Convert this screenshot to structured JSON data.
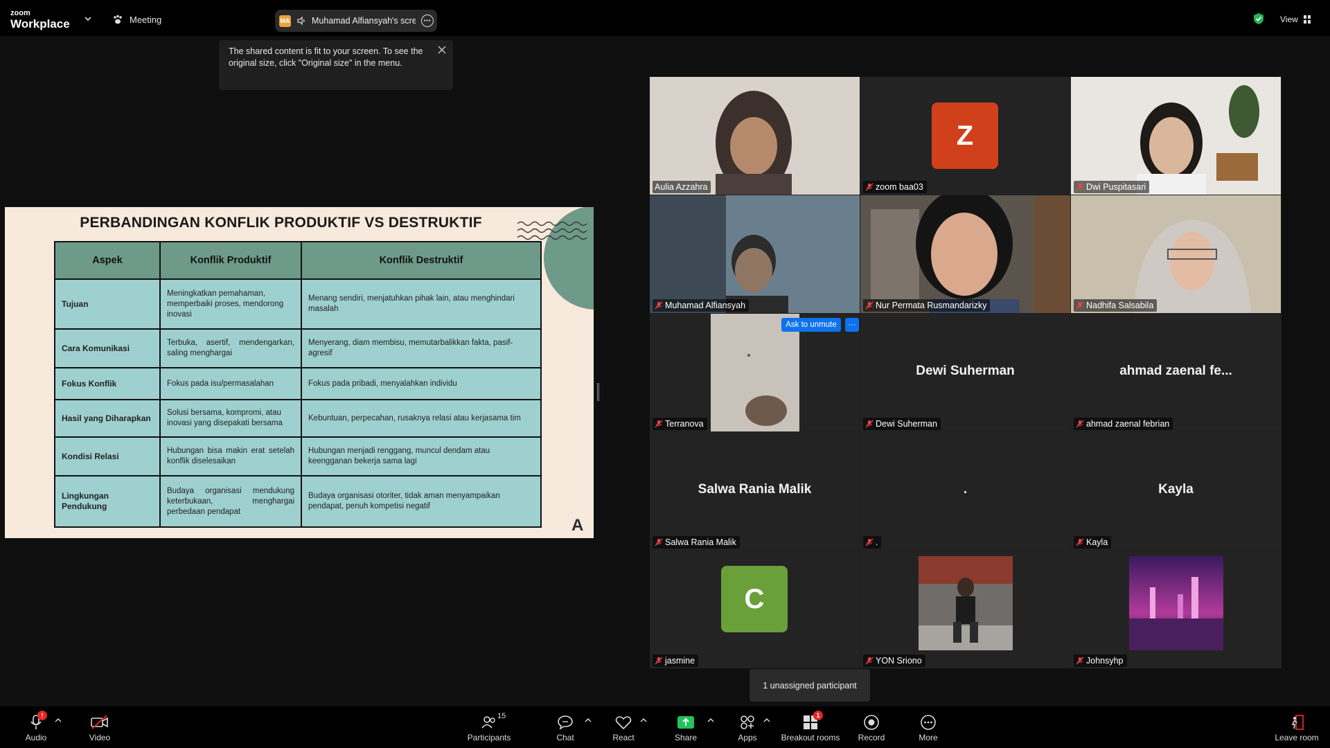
{
  "topbar": {
    "logo_small": "zoom",
    "logo_big": "Workplace",
    "meeting_label": "Meeting",
    "share_badge": "MA",
    "share_text": "Muhamad Alfiansyah's screen",
    "view_label": "View"
  },
  "tooltip": {
    "text": "The shared content is fit to your screen. To see the original size, click \"Original size\" in the menu."
  },
  "slide": {
    "title": "PERBANDINGAN KONFLIK PRODUKTIF VS DESTRUKTIF",
    "corner_letter": "A",
    "headers": [
      "Aspek",
      "Konflik Produktif",
      "Konflik Destruktif"
    ],
    "rows": [
      [
        "Tujuan",
        "Meningkatkan pemahaman, memperbaiki proses, mendorong inovasi",
        "Menang sendiri, menjatuhkan pihak lain, atau menghindari masalah"
      ],
      [
        "Cara Komunikasi",
        "Terbuka, asertif, mendengarkan, saling menghargai",
        "Menyerang, diam membisu, memutarbalikkan fakta, pasif-agresif"
      ],
      [
        "Fokus Konflik",
        "Fokus pada isu/permasalahan",
        "Fokus pada pribadi, menyalahkan individu"
      ],
      [
        "Hasil yang Diharapkan",
        "Solusi bersama, kompromi, atau inovasi yang disepakati bersama",
        "Kebuntuan, perpecahan, rusaknya relasi atau kerjasama tim"
      ],
      [
        "Kondisi Relasi",
        "Hubungan bisa makin erat setelah konflik diselesaikan",
        "Hubungan menjadi renggang, muncul dendam atau keengganan bekerja sama lagi"
      ],
      [
        "Lingkungan Pendukung",
        "Budaya organisasi mendukung keterbukaan, menghargai perbedaan pendapat",
        "Budaya organisasi otoriter, tidak aman menyampaikan pendapat, penuh kompetisi negatif"
      ]
    ]
  },
  "gallery": {
    "ask_to_unmute": "Ask to unmute",
    "more": "···",
    "tiles": [
      {
        "name": "Aulia Azzahra",
        "big": ""
      },
      {
        "name": "zoom baa03",
        "big": "",
        "avatar": "Z"
      },
      {
        "name": "Dwi Puspitasari",
        "big": ""
      },
      {
        "name": "Muhamad Alfiansyah",
        "big": ""
      },
      {
        "name": "Nur Permata Rusmandarizky",
        "big": ""
      },
      {
        "name": "Nadhifa Salsabila",
        "big": ""
      },
      {
        "name": "Terranova",
        "big": ""
      },
      {
        "name": "Dewi Suherman",
        "big": "Dewi Suherman"
      },
      {
        "name": "ahmad zaenal febrian",
        "big": "ahmad zaenal fe..."
      },
      {
        "name": "Salwa Rania Malik",
        "big": "Salwa Rania Malik"
      },
      {
        "name": ".",
        "big": "."
      },
      {
        "name": "Kayla",
        "big": "Kayla"
      },
      {
        "name": "jasmine",
        "big": "",
        "avatar": "C"
      },
      {
        "name": "YON Sriono",
        "big": ""
      },
      {
        "name": "Johnsyhp",
        "big": ""
      }
    ],
    "unassigned": "1 unassigned participant"
  },
  "colors": {
    "zoom_avatar": "#d0401b",
    "jasmine_avatar": "#6aa03a",
    "active_speaker": "#2ad17b",
    "unmute_blue": "#0e72ed",
    "slide_header": "#6e9a8a",
    "slide_cell": "#9fd0d0"
  },
  "toolbar": {
    "audio": "Audio",
    "audio_badge": "!",
    "video": "Video",
    "participants": "Participants",
    "participants_count": "15",
    "chat": "Chat",
    "react": "React",
    "share": "Share",
    "apps": "Apps",
    "breakout": "Breakout rooms",
    "breakout_badge": "1",
    "record": "Record",
    "more": "More",
    "leave": "Leave room"
  }
}
